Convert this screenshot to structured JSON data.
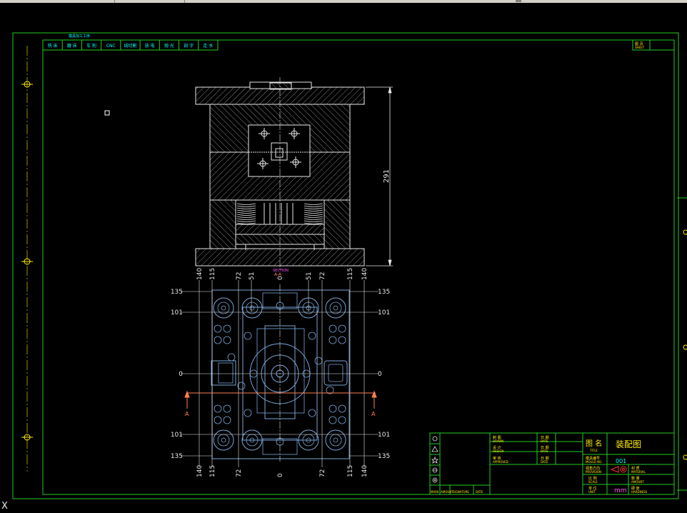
{
  "colors": {
    "frame": "#22cc22",
    "outline": "#e6e6e6",
    "plan": "#7aa6d6",
    "yellow": "#ffee00",
    "cyan": "#00ffff",
    "section_arrow": "#ff7f50",
    "red": "#ff3333",
    "magenta": "#ff55ff"
  },
  "process_table": {
    "title": "模具加工工序:",
    "cells": [
      "铣 床",
      "磨 床",
      "车 削",
      "CNC",
      "线切割",
      "放 电",
      "抛 光",
      "刻 字",
      "走 水"
    ]
  },
  "sheet_box": {
    "cn": "图 页",
    "en": "SHEET"
  },
  "section": {
    "title": "SECTION",
    "name": "A-A",
    "height_dim": "291",
    "arrow_label": "A"
  },
  "plan_dims": {
    "top": [
      "140",
      "115",
      "72",
      "51",
      "0",
      "51",
      "72",
      "115",
      "140"
    ],
    "bottom": [
      "140",
      "115",
      "72",
      "0",
      "72",
      "115",
      "140"
    ],
    "left": [
      "135",
      "101",
      "0",
      "101",
      "135"
    ],
    "right": [
      "135",
      "101",
      "0",
      "101",
      "135"
    ]
  },
  "title_block": {
    "rows": [
      {
        "cn": "制 图",
        "en": "DRAWN",
        "date_cn": "日 期",
        "date_en": "DATE"
      },
      {
        "cn": "设 计",
        "en": "DESIGN",
        "date_cn": "日 期",
        "date_en": "DATE"
      },
      {
        "cn": "审 核",
        "en": "APPROVED",
        "date_cn": "日 期",
        "date_en": "DATE"
      }
    ],
    "title_cn": "图 名",
    "title_en": "TITLE",
    "title_value": "装配图",
    "mold_no_cn": "模具编号",
    "mold_no_en": "MOULD NO.",
    "mold_no_value": "001",
    "projection_cn": "视角方向",
    "projection_en": "PROVISION",
    "material_cn": "材 质",
    "material_en": "MATERIAL",
    "scale_cn": "比 例",
    "scale_en": "SCALE",
    "amount_cn": "数 量",
    "amount_en": "AMOUNT",
    "unit_cn": "单 位",
    "unit_en": "UNIT",
    "unit_value": "mm",
    "hardness_cn": "硬 度",
    "hardness_en": "HARDNESS",
    "rev_headers": [
      "MARK",
      "AMOUNT",
      "SIGNATURE",
      "DATE"
    ]
  },
  "ucs_label": "X"
}
